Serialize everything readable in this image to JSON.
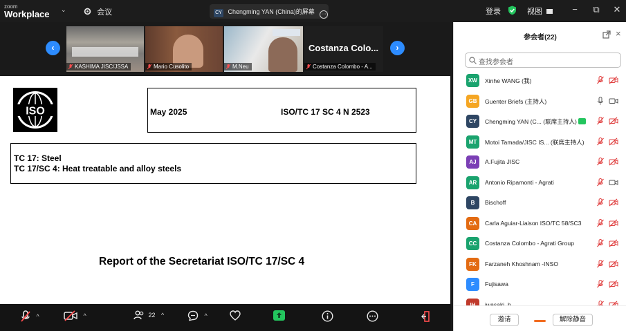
{
  "titlebar": {
    "brand_small": "zoom",
    "brand_big": "Workplace",
    "meeting_label": "会议",
    "share_label": "Chengming YAN (China)的屏幕",
    "share_initials": "CY",
    "login": "登录",
    "view": "视图"
  },
  "thumbnails": [
    {
      "name": "KASHIMA JISC/JSSA"
    },
    {
      "name": "Mario Cusolito"
    },
    {
      "name": "M.Neu"
    },
    {
      "name": "Costanza Colombo - A...",
      "display_name": "Costanza Colo..."
    }
  ],
  "document": {
    "date": "May 2025",
    "reference": "ISO/TC 17 SC 4 N 2523",
    "tc_line1": "TC 17: Steel",
    "tc_line2": "TC 17/SC 4: Heat treatable and alloy steels",
    "report_title": "Report of the Secretariat ISO/TC 17/SC 4"
  },
  "toolbar": {
    "participants_count": "22"
  },
  "panel": {
    "title": "参会者(22)",
    "search_placeholder": "查找参会者",
    "invite_label": "邀请",
    "unmute_label": "解除静音",
    "participants": [
      {
        "initials": "XW",
        "name": "Xinhe WANG (我)",
        "color": "#1aa36e",
        "mic": "muted",
        "cam": "off"
      },
      {
        "initials": "GB",
        "name": "Guenter Briefs (主持人)",
        "color": "#f5a623",
        "mic": "on",
        "cam": "on"
      },
      {
        "initials": "CY",
        "name": "Chengming YAN (C... (联席主持人)",
        "color": "#2e4663",
        "mic": "muted",
        "cam": "off",
        "sharing": true
      },
      {
        "initials": "MT",
        "name": "Motoi Tamada/JISC IS... (联席主持人)",
        "color": "#1aa36e",
        "mic": "muted",
        "cam": "off"
      },
      {
        "initials": "AJ",
        "name": "A.Fujita JISC",
        "color": "#7b3fb5",
        "mic": "muted",
        "cam": "off"
      },
      {
        "initials": "AR",
        "name": "Antonio Ripamonti - Agrati",
        "color": "#1aa36e",
        "mic": "muted",
        "cam": "on"
      },
      {
        "initials": "B",
        "name": "Bischoff",
        "color": "#2e4663",
        "mic": "muted",
        "cam": "off"
      },
      {
        "initials": "CA",
        "name": "Carla Aguiar-Liaison ISO/TC 58/SC3",
        "color": "#e36b12",
        "mic": "muted",
        "cam": "off"
      },
      {
        "initials": "CC",
        "name": "Costanza Colombo - Agrati Group",
        "color": "#1aa36e",
        "mic": "muted",
        "cam": "off"
      },
      {
        "initials": "FK",
        "name": "Farzaneh Khoshnam -INSO",
        "color": "#e36b12",
        "mic": "muted",
        "cam": "off"
      },
      {
        "initials": "F",
        "name": "Fujisawa",
        "color": "#2d8cff",
        "mic": "muted",
        "cam": "off"
      },
      {
        "initials": "IH",
        "name": "iwasaki_h",
        "color": "#c0392b",
        "mic": "muted",
        "cam": "off"
      }
    ]
  }
}
